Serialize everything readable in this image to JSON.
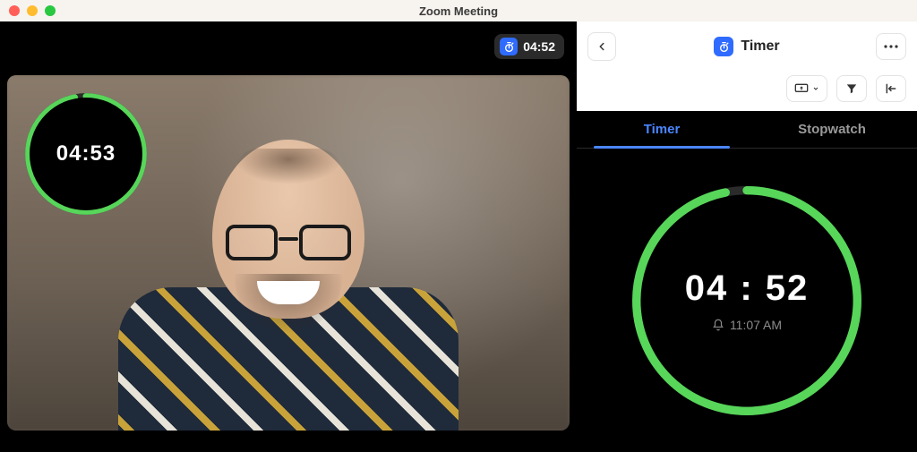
{
  "window": {
    "title": "Zoom Meeting"
  },
  "video": {
    "mini_timer": "04:52",
    "overlay_timer": "04:53",
    "overlay_progress_pct": 97
  },
  "side": {
    "title": "Timer",
    "tabs": {
      "timer": "Timer",
      "stopwatch": "Stopwatch",
      "active": "timer"
    },
    "big_timer": "04 : 52",
    "end_time": "11:07 AM",
    "progress_pct": 97
  },
  "colors": {
    "ring_green": "#57d65a",
    "ring_track": "#2b2b2b",
    "blue": "#2f6bff"
  },
  "icons": {
    "stopwatch": "stopwatch-icon",
    "back": "chevron-left-icon",
    "more": "ellipsis-icon",
    "screen": "screen-share-icon",
    "filter": "filter-icon",
    "collapse": "collapse-icon",
    "bell": "bell-icon"
  }
}
